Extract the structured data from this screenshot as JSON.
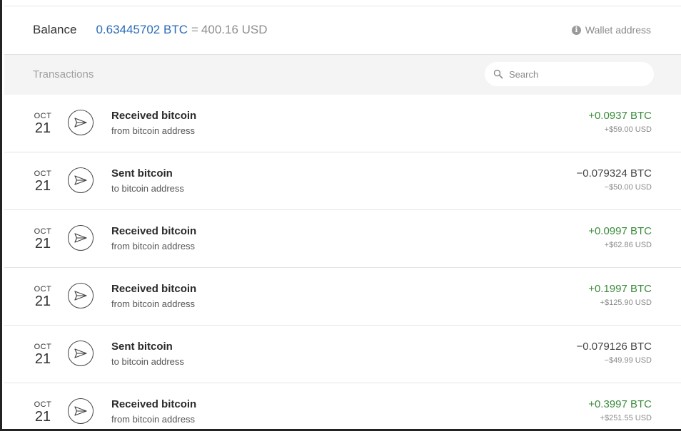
{
  "balance": {
    "label": "Balance",
    "btc": "0.63445702 BTC",
    "equals": "=",
    "usd": "400.16 USD",
    "wallet_address_label": "Wallet address",
    "info_icon": "i"
  },
  "transactions_header": {
    "title": "Transactions",
    "search_placeholder": "Search"
  },
  "colors": {
    "received": "#3a8a3a",
    "sent": "#444444",
    "balance_btc": "#2b6cb8"
  },
  "transactions": [
    {
      "month": "OCT",
      "day": "21",
      "title": "Received bitcoin",
      "subtitle": "from bitcoin address",
      "amount_btc": "+0.0937 BTC",
      "amount_usd": "+$59.00 USD",
      "direction": "received",
      "icon": "paper-plane-icon"
    },
    {
      "month": "OCT",
      "day": "21",
      "title": "Sent bitcoin",
      "subtitle": "to bitcoin address",
      "amount_btc": "−0.079324 BTC",
      "amount_usd": "−$50.00 USD",
      "direction": "sent",
      "icon": "paper-plane-icon"
    },
    {
      "month": "OCT",
      "day": "21",
      "title": "Received bitcoin",
      "subtitle": "from bitcoin address",
      "amount_btc": "+0.0997 BTC",
      "amount_usd": "+$62.86 USD",
      "direction": "received",
      "icon": "paper-plane-icon"
    },
    {
      "month": "OCT",
      "day": "21",
      "title": "Received bitcoin",
      "subtitle": "from bitcoin address",
      "amount_btc": "+0.1997 BTC",
      "amount_usd": "+$125.90 USD",
      "direction": "received",
      "icon": "paper-plane-icon"
    },
    {
      "month": "OCT",
      "day": "21",
      "title": "Sent bitcoin",
      "subtitle": "to bitcoin address",
      "amount_btc": "−0.079126 BTC",
      "amount_usd": "−$49.99 USD",
      "direction": "sent",
      "icon": "paper-plane-icon"
    },
    {
      "month": "OCT",
      "day": "21",
      "title": "Received bitcoin",
      "subtitle": "from bitcoin address",
      "amount_btc": "+0.3997 BTC",
      "amount_usd": "+$251.55 USD",
      "direction": "received",
      "icon": "paper-plane-icon"
    }
  ]
}
